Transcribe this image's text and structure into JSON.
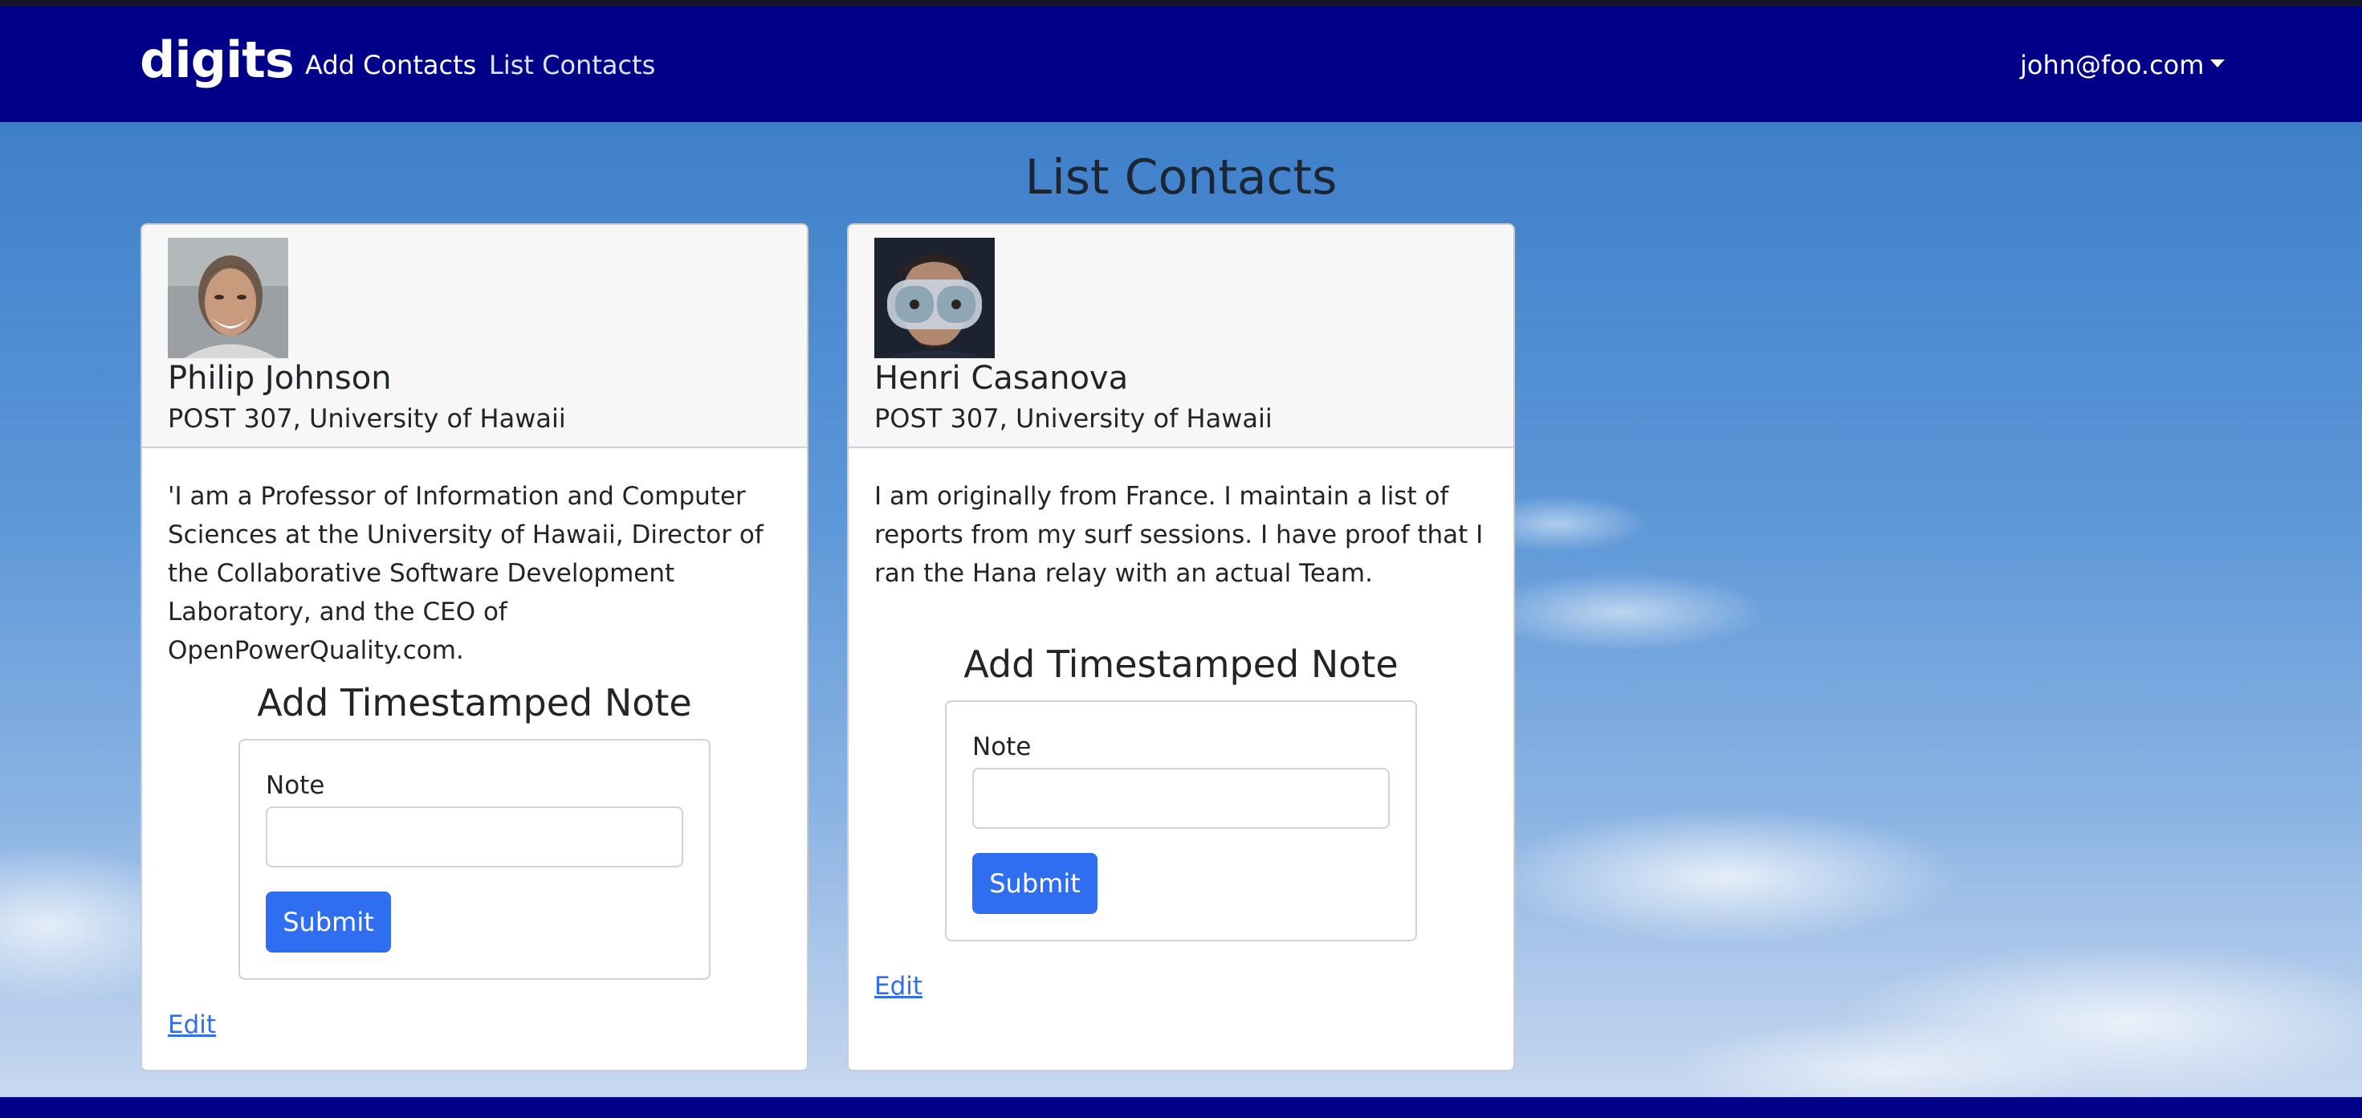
{
  "navbar": {
    "brand": "digits",
    "links": [
      "Add Contacts",
      "List Contacts"
    ],
    "user": "john@foo.com"
  },
  "page": {
    "title": "List Contacts"
  },
  "contacts": [
    {
      "name": "Philip Johnson",
      "address": "POST 307, University of Hawaii",
      "description": "'I am a Professor of Information and Computer Sciences at the University of Hawaii, Director of the Collaborative Software Development Laboratory, and the CEO of OpenPowerQuality.com.",
      "note_title": "Add Timestamped Note",
      "note_label": "Note",
      "note_value": "",
      "submit_label": "Submit",
      "edit_label": "Edit"
    },
    {
      "name": "Henri Casanova",
      "address": "POST 307, University of Hawaii",
      "description": "I am originally from France. I maintain a list of reports from my surf sessions. I have proof that I ran the Hana relay with an actual Team.",
      "note_title": "Add Timestamped Note",
      "note_label": "Note",
      "note_value": "",
      "submit_label": "Submit",
      "edit_label": "Edit"
    }
  ],
  "colors": {
    "navbar": "#000088",
    "primary": "#2f6ef0",
    "link": "#2f6ef0"
  }
}
